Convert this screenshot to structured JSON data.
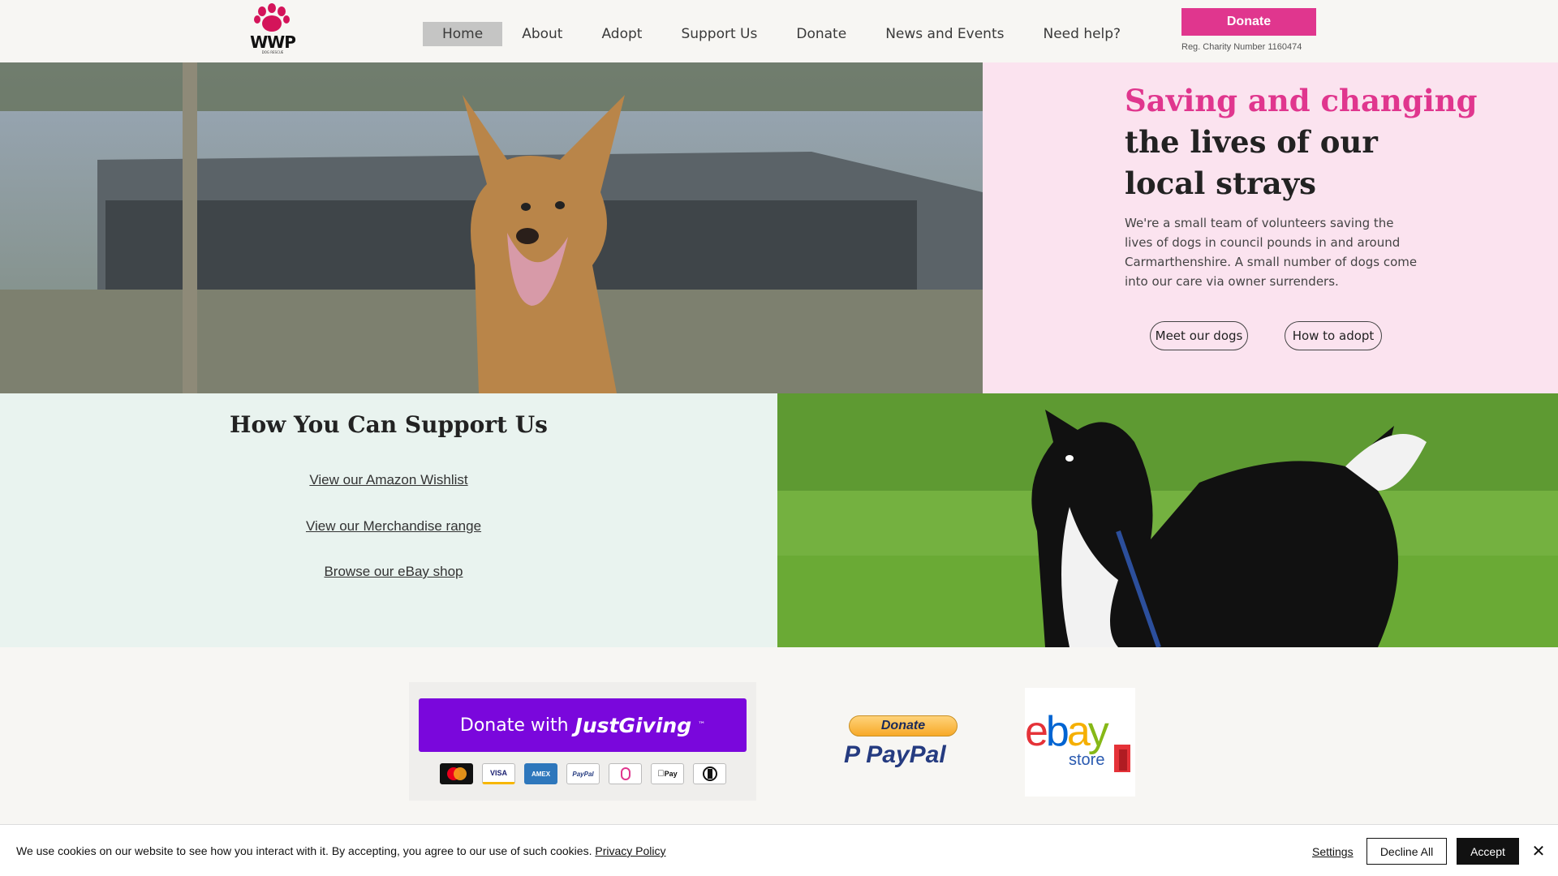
{
  "header": {
    "logo_text": "WWP",
    "logo_sub": "DOG RESCUE",
    "nav": [
      "Home",
      "About",
      "Adopt",
      "Support Us",
      "Donate",
      "News and Events",
      "Need help?"
    ],
    "donate_label": "Donate",
    "reg_number": "Reg. Charity Number 1160474"
  },
  "hero": {
    "title_highlight": "Saving and changing",
    "title_rest": "the lives of our local strays",
    "description": "We're a small team of volunteers saving the lives of dogs in council pounds in and around Carmarthenshire. A small number of dogs come into our care via owner surrenders.",
    "btn_meet": "Meet our dogs",
    "btn_adopt": "How to adopt"
  },
  "support": {
    "title": "How You Can Support Us",
    "links": [
      "View our Amazon Wishlist",
      "View our Merchandise range",
      "Browse our eBay shop"
    ]
  },
  "donate_strip": {
    "jg_prefix": "Donate with",
    "jg_brand": "JustGiving",
    "jg_tm": "™",
    "payment_icons": [
      "mastercard-icon",
      "visa-icon",
      "amex-icon",
      "paypal-icon",
      "klarna-icon",
      "applepay-icon",
      "diners-icon"
    ],
    "visa_text": "VISA",
    "amex_text": "AMEX",
    "paypal_text": "PayPal",
    "applepay_text": "Pay",
    "pp_button": "Donate",
    "pp_logo": "PayPal",
    "ebay_store": "store"
  },
  "cookie": {
    "text": "We use cookies on our website to see how you interact with it. By accepting, you agree to our use of such cookies.",
    "policy": "Privacy Policy",
    "settings": "Settings",
    "decline": "Decline All",
    "accept": "Accept"
  },
  "colors": {
    "brand_pink": "#e0368e",
    "hero_panel": "#fbe3ef",
    "support_bg": "#e9f3ef",
    "justgiving": "#7a07dc"
  }
}
